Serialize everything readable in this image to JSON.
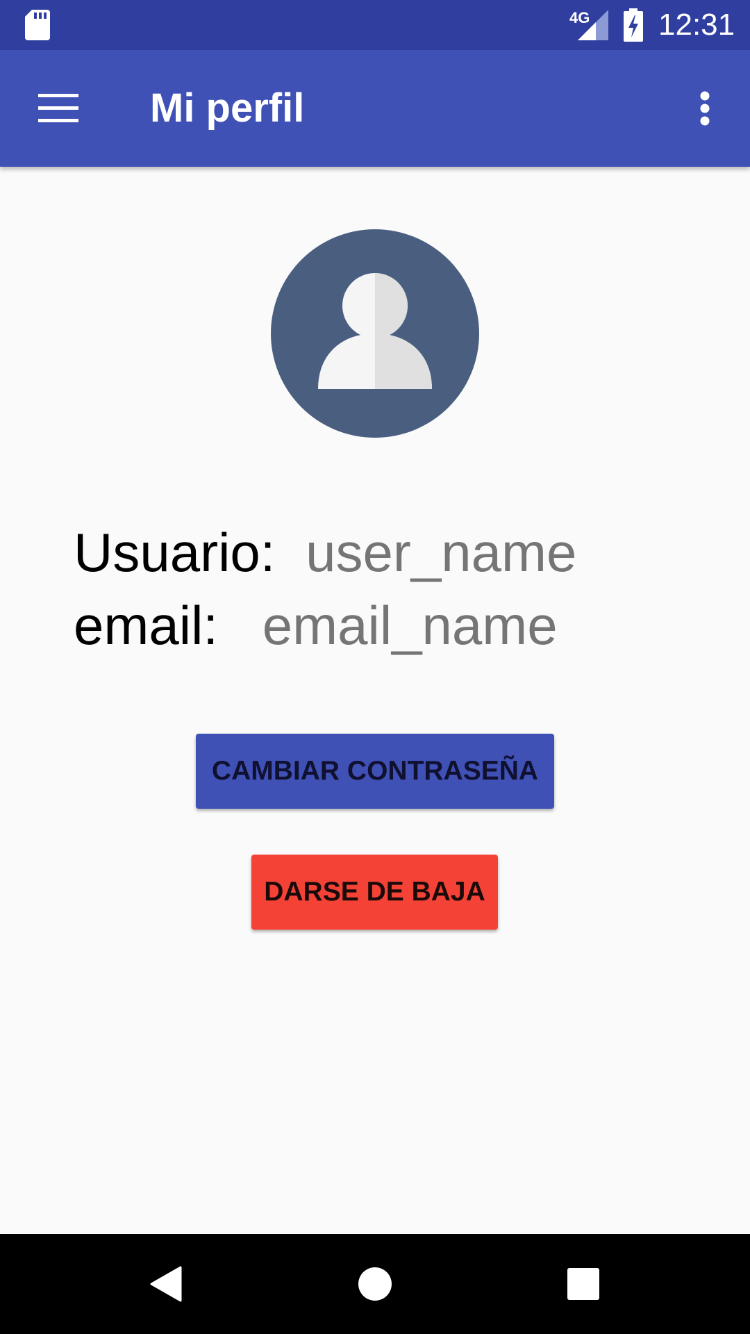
{
  "status_bar": {
    "network": "4G",
    "time": "12:31"
  },
  "app_bar": {
    "title": "Mi perfil"
  },
  "profile": {
    "user_label": "Usuario:",
    "user_value": "user_name",
    "email_label": "email:",
    "email_value": "email_name"
  },
  "buttons": {
    "change_password": "CAMBIAR CONTRASEÑA",
    "unsubscribe": "DARSE DE BAJA"
  },
  "colors": {
    "status_bar": "#303f9f",
    "app_bar": "#3f51b5",
    "avatar_bg": "#4a5f80",
    "primary_button": "#3f51b5",
    "danger_button": "#f44336"
  },
  "icons": {
    "status": [
      "sd-card-icon",
      "signal-icon",
      "battery-charging-icon"
    ],
    "app_bar": [
      "menu-icon",
      "more-vert-icon"
    ],
    "nav": [
      "back-icon",
      "home-icon",
      "recents-icon"
    ]
  }
}
